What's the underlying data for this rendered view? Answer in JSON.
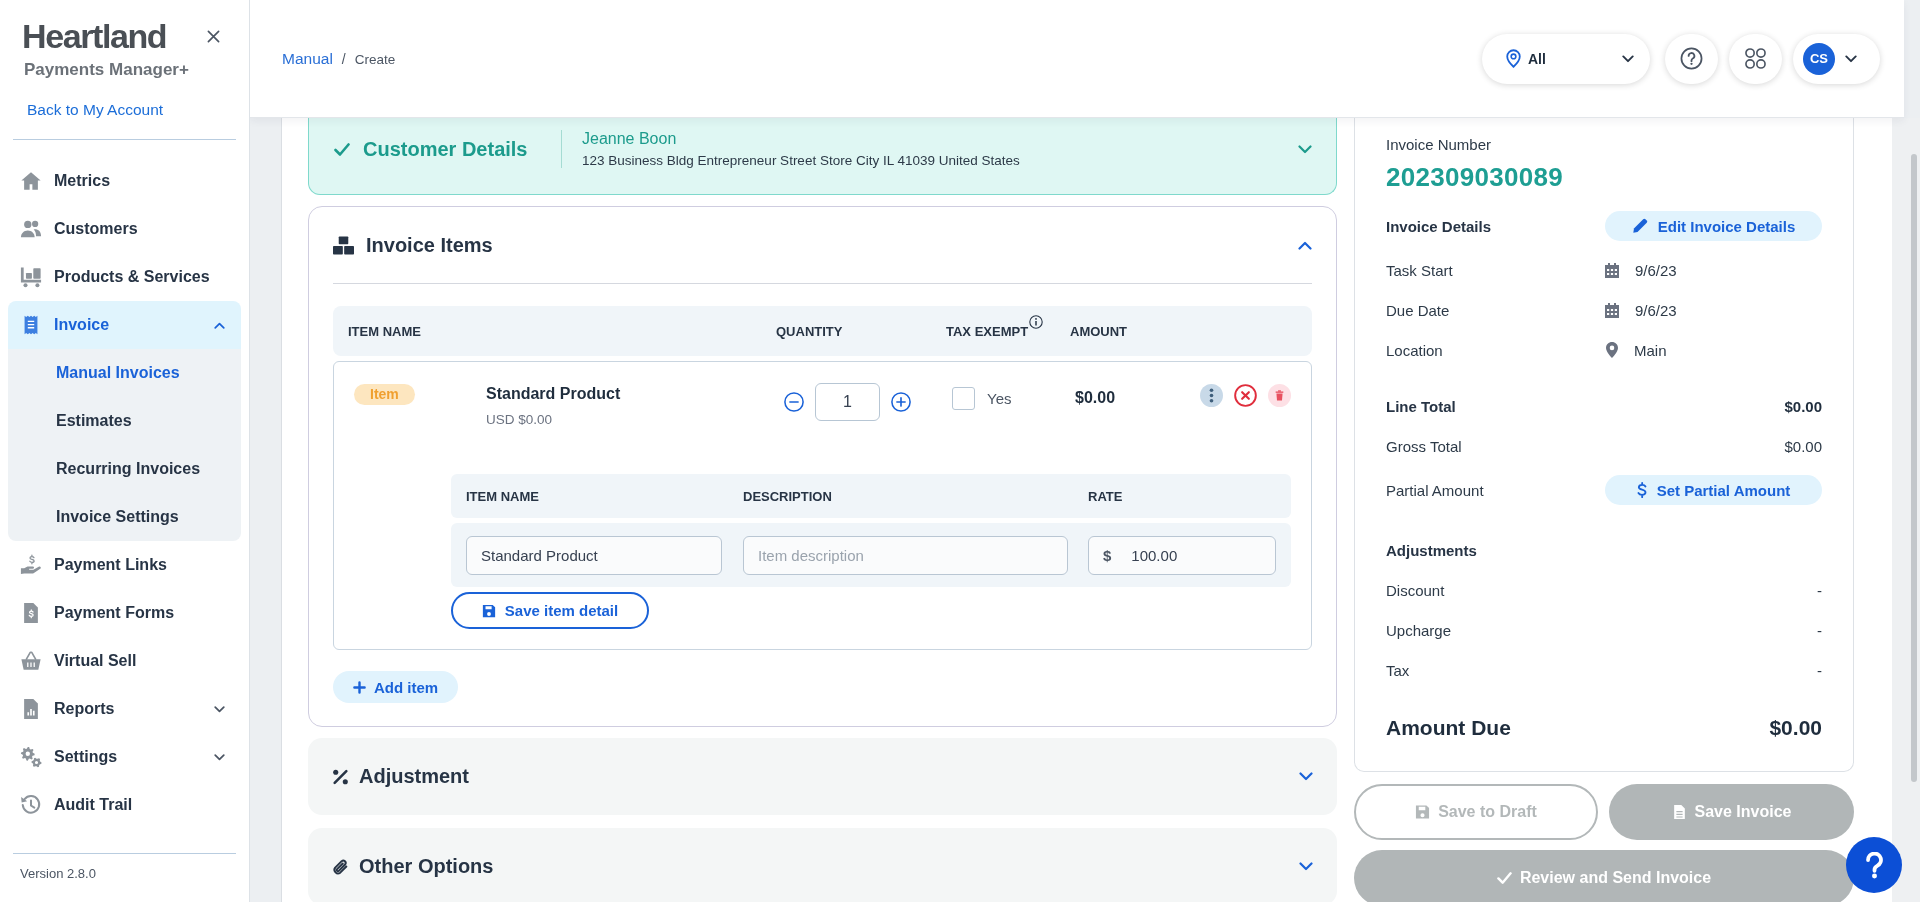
{
  "sidebar": {
    "brand": "Heartland",
    "product": "Payments Manager+",
    "back_link": "Back to My Account",
    "items": [
      {
        "label": "Metrics",
        "kind": "link",
        "selected": false
      },
      {
        "label": "Customers",
        "kind": "link",
        "selected": false
      },
      {
        "label": "Products & Services",
        "kind": "link",
        "selected": false
      },
      {
        "label": "Invoice",
        "kind": "group",
        "selected": true,
        "expanded": true,
        "children": [
          {
            "label": "Manual Invoices",
            "selected": true
          },
          {
            "label": "Estimates",
            "selected": false
          },
          {
            "label": "Recurring Invoices",
            "selected": false
          },
          {
            "label": "Invoice Settings",
            "selected": false
          }
        ]
      },
      {
        "label": "Payment Links",
        "kind": "link",
        "selected": false
      },
      {
        "label": "Payment Forms",
        "kind": "link",
        "selected": false
      },
      {
        "label": "Virtual Sell",
        "kind": "link",
        "selected": false
      },
      {
        "label": "Reports",
        "kind": "group",
        "selected": false,
        "expanded": false
      },
      {
        "label": "Settings",
        "kind": "group",
        "selected": false,
        "expanded": false
      },
      {
        "label": "Audit Trail",
        "kind": "link",
        "selected": false
      }
    ],
    "version": "Version 2.8.0"
  },
  "header": {
    "breadcrumb": [
      {
        "label": "Manual",
        "kind": "link"
      },
      {
        "label": "Create",
        "kind": "current"
      }
    ],
    "breadcrumb_separator": "/",
    "location_filter": "All",
    "avatar": "CS"
  },
  "customer_details": {
    "title": "Customer Details",
    "completed": true,
    "expanded": false,
    "name": "Jeanne Boon",
    "address": "123 Business Bldg Entrepreneur Street Store City IL 41039 United States"
  },
  "invoice_items": {
    "title": "Invoice Items",
    "expanded": true,
    "columns": [
      {
        "label": "ITEM NAME",
        "info": false
      },
      {
        "label": "QUANTITY",
        "info": false
      },
      {
        "label": "TAX EXEMPT",
        "info": true
      },
      {
        "label": "AMOUNT",
        "info": false
      }
    ],
    "items": [
      {
        "tag": "Item",
        "name": "Standard Product",
        "price": "USD $0.00",
        "quantity": "1",
        "tax_exempt": false,
        "tax_exempt_label": "Yes",
        "amount": "$0.00",
        "detail": {
          "columns": [
            "ITEM NAME",
            "DESCRIPTION",
            "RATE"
          ],
          "name": "Standard Product",
          "description_placeholder": "Item description",
          "currency": "$",
          "rate": "100.00",
          "save_button": "Save item detail"
        }
      }
    ],
    "add_button": "Add item"
  },
  "sections": [
    {
      "title": "Adjustment",
      "expanded": false
    },
    {
      "title": "Other Options",
      "expanded": false
    }
  ],
  "summary": {
    "number_label": "Invoice Number",
    "number": "202309030089",
    "details_title": "Invoice Details",
    "edit_button": "Edit Invoice Details",
    "details": [
      {
        "label": "Task Start",
        "value": "9/6/23",
        "kind": "date"
      },
      {
        "label": "Due Date",
        "value": "9/6/23",
        "kind": "date"
      },
      {
        "label": "Location",
        "value": "Main",
        "kind": "location"
      }
    ],
    "totals": [
      {
        "label": "Line Total",
        "value": "$0.00",
        "kind": "strong"
      },
      {
        "label": "Gross Total",
        "value": "$0.00",
        "kind": "plain"
      },
      {
        "label": "Partial Amount",
        "action": "Set Partial Amount",
        "kind": "action"
      }
    ],
    "adjustments_title": "Adjustments",
    "adjustments": [
      {
        "label": "Discount",
        "value": "-"
      },
      {
        "label": "Upcharge",
        "value": "-"
      },
      {
        "label": "Tax",
        "value": "-"
      }
    ],
    "amount_due_label": "Amount Due",
    "amount_due": "$0.00"
  },
  "actions": [
    {
      "label": "Save to Draft",
      "kind": "outline",
      "disabled": true
    },
    {
      "label": "Save Invoice",
      "kind": "filled",
      "disabled": true
    },
    {
      "label": "Review and Send Invoice",
      "kind": "filled",
      "disabled": true
    }
  ]
}
